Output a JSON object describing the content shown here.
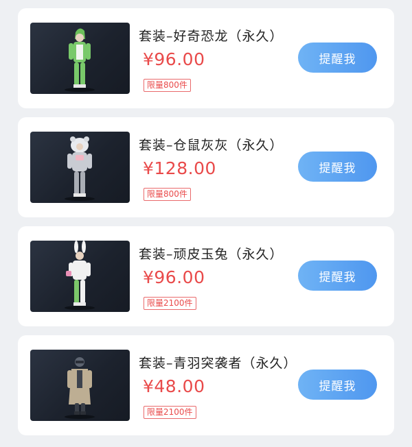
{
  "items": [
    {
      "name": "套装–好奇恐龙（永久）",
      "price": "¥96.00",
      "limit": "限量800件",
      "button": "提醒我",
      "outfit": "dinosaur-costume",
      "accent": "#7cc86a"
    },
    {
      "name": "套装–仓鼠灰灰（永久）",
      "price": "¥128.00",
      "limit": "限量800件",
      "button": "提醒我",
      "outfit": "hamster-costume",
      "accent": "#b9bec6"
    },
    {
      "name": "套装–顽皮玉兔（永久）",
      "price": "¥96.00",
      "limit": "限量2100件",
      "button": "提醒我",
      "outfit": "bunny-costume",
      "accent": "#f0f0f0"
    },
    {
      "name": "套装–青羽突袭者（永久）",
      "price": "¥48.00",
      "limit": "限量2100件",
      "button": "提醒我",
      "outfit": "raider-coat",
      "accent": "#b7a98e"
    }
  ],
  "colors": {
    "price": "#e94a4a",
    "button_start": "#6fb3f5",
    "button_end": "#4f97ef",
    "page_bg": "#eef0f3"
  }
}
